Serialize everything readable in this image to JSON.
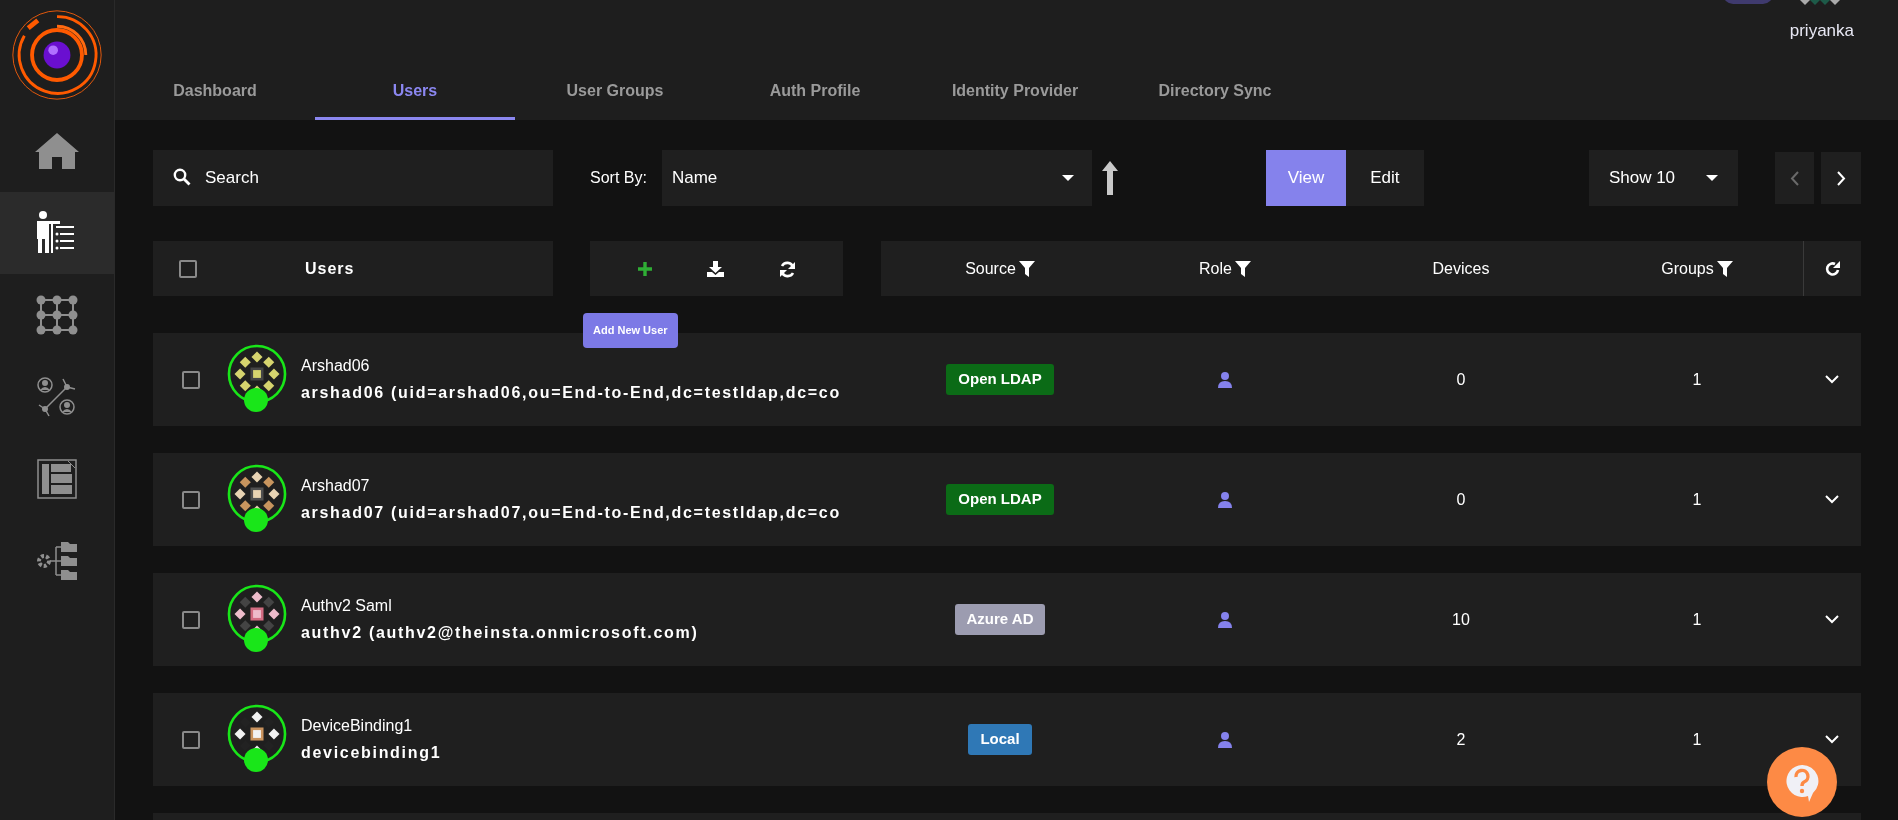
{
  "header": {
    "user_name": "priyanka"
  },
  "sidebar": {
    "items": [
      {
        "kind": "home",
        "selected": false
      },
      {
        "kind": "users",
        "selected": true
      },
      {
        "kind": "grid",
        "selected": false
      },
      {
        "kind": "network",
        "selected": false
      },
      {
        "kind": "document",
        "selected": false
      },
      {
        "kind": "settings-tree",
        "selected": false
      }
    ]
  },
  "tabs": [
    {
      "label": "Dashboard",
      "selected": false
    },
    {
      "label": "Users",
      "selected": true
    },
    {
      "label": "User Groups",
      "selected": false
    },
    {
      "label": "Auth Profile",
      "selected": false
    },
    {
      "label": "Identity Provider",
      "selected": false
    },
    {
      "label": "Directory Sync",
      "selected": false
    }
  ],
  "toolbar": {
    "search": {
      "placeholder": "Search"
    },
    "sort_label": "Sort By:",
    "sort_value": "Name",
    "mode_buttons": [
      {
        "label": "View",
        "selected": true
      },
      {
        "label": "Edit",
        "selected": false
      }
    ],
    "page_size": "Show 10",
    "prev_disabled": true,
    "next_disabled": false
  },
  "table": {
    "select_all_checked": false,
    "users_heading": "Users",
    "add_tooltip": "Add New User",
    "columns": [
      {
        "label": "Source",
        "filter": true
      },
      {
        "label": "Role",
        "filter": true
      },
      {
        "label": "Devices",
        "filter": false
      },
      {
        "label": "Groups",
        "filter": true
      }
    ],
    "rows": [
      {
        "name": "Arshad06",
        "detail": "arshad06 (uid=arshad06,ou=End-to-End,dc=testldap,dc=co",
        "checked": false,
        "online": true,
        "source": {
          "label": "Open LDAP",
          "color": "#0b6b16"
        },
        "devices": "0",
        "groups": "1"
      },
      {
        "name": "Arshad07",
        "detail": "arshad07 (uid=arshad07,ou=End-to-End,dc=testldap,dc=co",
        "checked": false,
        "online": true,
        "source": {
          "label": "Open LDAP",
          "color": "#0b6b16"
        },
        "devices": "0",
        "groups": "1"
      },
      {
        "name": "Authv2 Saml",
        "detail": "authv2 (authv2@theinsta.onmicrosoft.com)",
        "checked": false,
        "online": true,
        "source": {
          "label": "Azure AD",
          "color": "#9c9cb0"
        },
        "devices": "10",
        "groups": "1"
      },
      {
        "name": "DeviceBinding1",
        "detail": "devicebinding1",
        "checked": false,
        "online": true,
        "source": {
          "label": "Local",
          "color": "#2f78b6"
        },
        "devices": "2",
        "groups": "1"
      }
    ]
  }
}
